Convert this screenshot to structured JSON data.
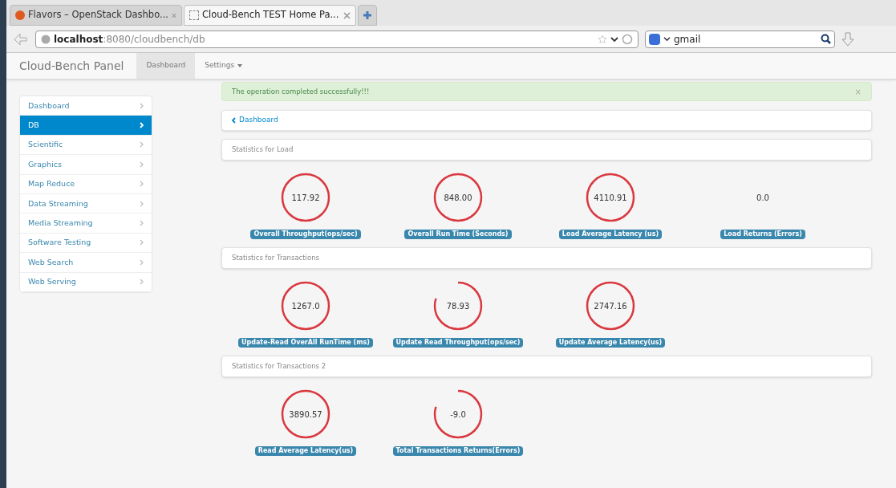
{
  "browser": {
    "tabs": [
      {
        "title": "Flavors – OpenStack Dashbo...",
        "selected": false,
        "kind": "openstack"
      },
      {
        "title": "Cloud-Bench TEST Home Pa...",
        "selected": true,
        "kind": "blank"
      }
    ],
    "url": {
      "host": "localhost",
      "path": ":8080/cloudbench/db"
    },
    "search": {
      "value": "gmail"
    }
  },
  "navbar": {
    "brand": "Cloud-Bench Panel",
    "items": [
      {
        "label": "Dashboard",
        "selected": true,
        "dropdown": false
      },
      {
        "label": "Settings",
        "selected": false,
        "dropdown": true
      }
    ]
  },
  "sidebar": {
    "items": [
      {
        "label": "Dashboard",
        "selected": false
      },
      {
        "label": "DB",
        "selected": true
      },
      {
        "label": "Scientific",
        "selected": false
      },
      {
        "label": "Graphics",
        "selected": false
      },
      {
        "label": "Map Reduce",
        "selected": false
      },
      {
        "label": "Data Streaming",
        "selected": false
      },
      {
        "label": "Media Streaming",
        "selected": false
      },
      {
        "label": "Software Testing",
        "selected": false
      },
      {
        "label": "Web Search",
        "selected": false
      },
      {
        "label": "Web Serving",
        "selected": false
      }
    ]
  },
  "alert": {
    "text": "The operation completed successfully!!!",
    "close": "×"
  },
  "breadcrumb": {
    "label": "Dashboard"
  },
  "sections": [
    {
      "title": "Statistics for Load",
      "gauges": [
        {
          "value": "117.92",
          "label": "Overall Throughput(ops/sec)",
          "kind": "ring"
        },
        {
          "value": "848.00",
          "label": "Overall Run Time (Seconds)",
          "kind": "ring"
        },
        {
          "value": "4110.91",
          "label": "Load Average Latency (us)",
          "kind": "ring"
        },
        {
          "value": "0.0",
          "label": "Load Returns (Errors)",
          "kind": "plain"
        }
      ]
    },
    {
      "title": "Statistics for Transactions",
      "gauges": [
        {
          "value": "1267.0",
          "label": "Update-Read OverAll RunTime (ms)",
          "kind": "ring"
        },
        {
          "value": "78.93",
          "label": "Update Read Throughput(ops/sec)",
          "kind": "arc"
        },
        {
          "value": "2747.16",
          "label": "Update Average Latency(us)",
          "kind": "ring"
        }
      ]
    },
    {
      "title": "Statistics for Transactions 2",
      "gauges": [
        {
          "value": "3890.57",
          "label": "Read Average Latency(us)",
          "kind": "ring"
        },
        {
          "value": "-9.0",
          "label": "Total Transactions Returns(Errors)",
          "kind": "arc"
        }
      ]
    }
  ]
}
